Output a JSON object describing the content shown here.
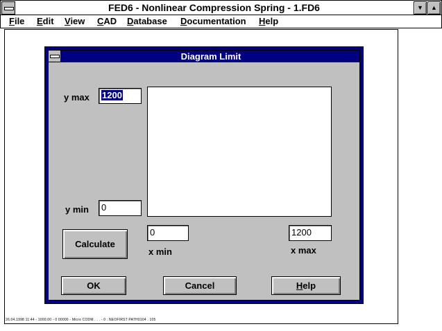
{
  "window": {
    "title": "FED6 - Nonlinear Compression Spring  - 1.FD6",
    "minimize_glyph": "▼",
    "maximize_glyph": "▲"
  },
  "menu": {
    "items": [
      {
        "first": "F",
        "rest": "ile"
      },
      {
        "first": "E",
        "rest": "dit"
      },
      {
        "first": "V",
        "rest": "iew"
      },
      {
        "first": "C",
        "rest": "AD"
      },
      {
        "first": "D",
        "rest": "atabase"
      },
      {
        "first": "D",
        "rest": "ocumentation"
      },
      {
        "first": "H",
        "rest": "elp"
      }
    ]
  },
  "status_line": "26.04.1998 11:44 - 1000.00 - 0 00000 - Micro CODM . . . - 0 : NEOFIRST PATH0104 . 105",
  "dialog": {
    "title": "Diagram Limit",
    "ymax_label": "y max",
    "ymax_value": "1200",
    "ymin_label": "y min",
    "ymin_value": "0",
    "xmin_label": "x min",
    "xmin_value": "0",
    "xmax_label": "x max",
    "xmax_value": "1200",
    "calculate_label": "Calculate",
    "ok_label": "OK",
    "cancel_label": "Cancel",
    "help_first": "H",
    "help_rest": "elp"
  }
}
